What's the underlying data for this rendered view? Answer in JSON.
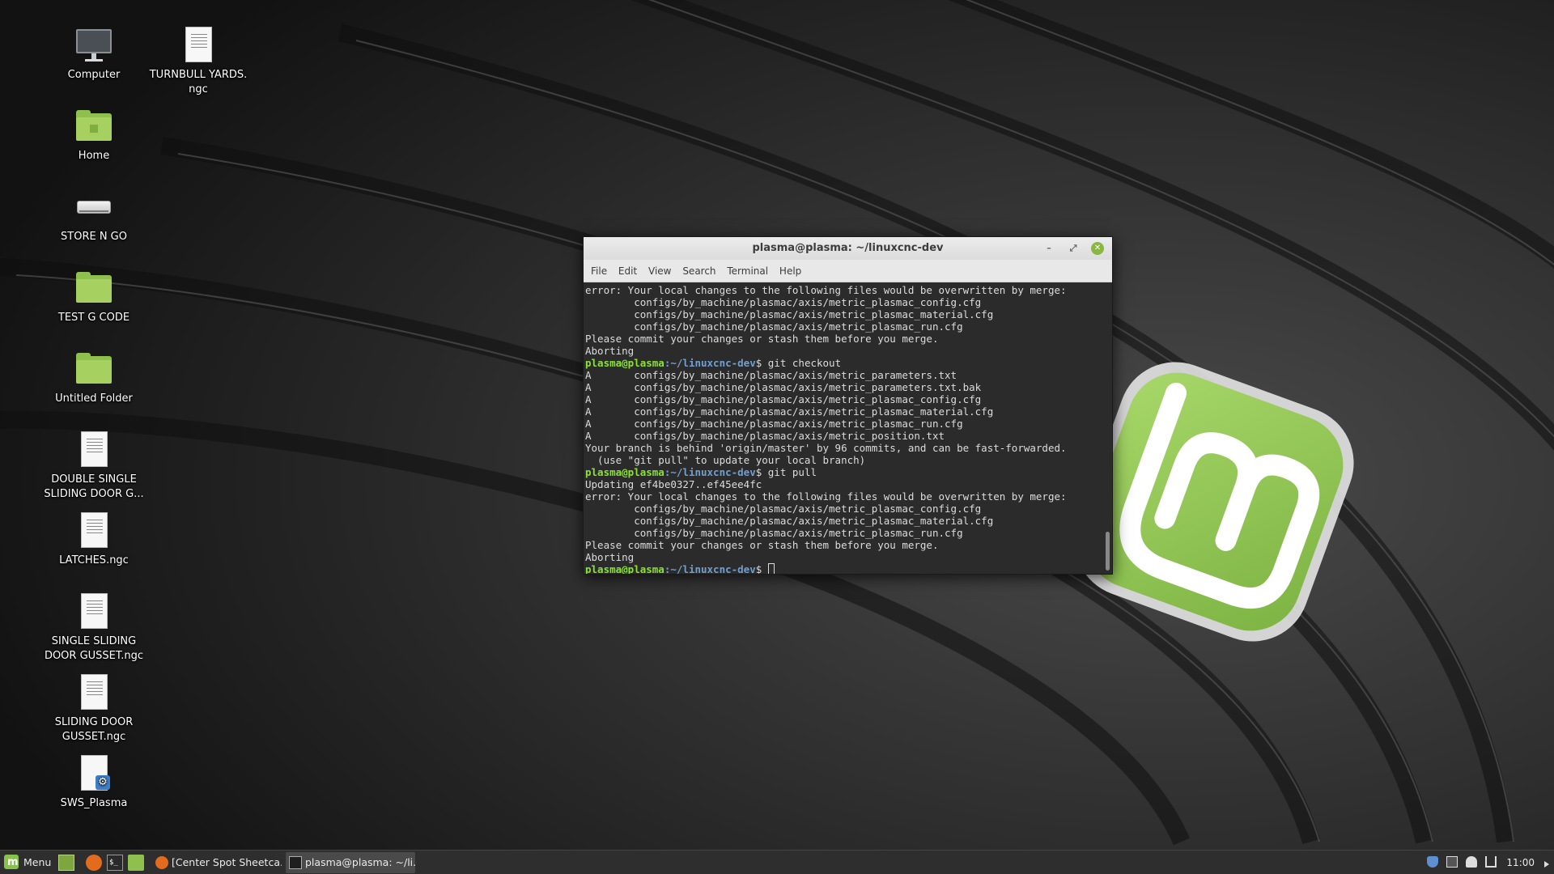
{
  "desktop": {
    "icons": [
      {
        "label": "Computer",
        "type": "computer"
      },
      {
        "label": "TURNBULL YARDS.\nngc",
        "type": "document"
      },
      {
        "label": "Home",
        "type": "home-folder"
      },
      {
        "label": "STORE N GO",
        "type": "drive"
      },
      {
        "label": "TEST G CODE",
        "type": "folder"
      },
      {
        "label": "Untitled Folder",
        "type": "folder"
      },
      {
        "label": "DOUBLE SINGLE\nSLIDING DOOR G...",
        "type": "document"
      },
      {
        "label": "LATCHES.ngc",
        "type": "document"
      },
      {
        "label": "SINGLE SLIDING\nDOOR GUSSET.ngc",
        "type": "document"
      },
      {
        "label": "SLIDING DOOR\nGUSSET.ngc",
        "type": "document"
      },
      {
        "label": "SWS_Plasma",
        "type": "executable"
      }
    ]
  },
  "terminal": {
    "title": "plasma@plasma: ~/linuxcnc-dev",
    "menu": [
      "File",
      "Edit",
      "View",
      "Search",
      "Terminal",
      "Help"
    ],
    "prompt_user": "plasma@plasma",
    "prompt_path": ":~/linuxcnc-dev",
    "prompt_symbol": "$ ",
    "lines": [
      {
        "text": "error: Your local changes to the following files would be overwritten by merge:"
      },
      {
        "text": "        configs/by_machine/plasmac/axis/metric_plasmac_config.cfg"
      },
      {
        "text": "        configs/by_machine/plasmac/axis/metric_plasmac_material.cfg"
      },
      {
        "text": "        configs/by_machine/plasmac/axis/metric_plasmac_run.cfg"
      },
      {
        "text": "Please commit your changes or stash them before you merge."
      },
      {
        "text": "Aborting"
      },
      {
        "prompt": true,
        "text": "git checkout"
      },
      {
        "text": "A       configs/by_machine/plasmac/axis/metric_parameters.txt"
      },
      {
        "text": "A       configs/by_machine/plasmac/axis/metric_parameters.txt.bak"
      },
      {
        "text": "A       configs/by_machine/plasmac/axis/metric_plasmac_config.cfg"
      },
      {
        "text": "A       configs/by_machine/plasmac/axis/metric_plasmac_material.cfg"
      },
      {
        "text": "A       configs/by_machine/plasmac/axis/metric_plasmac_run.cfg"
      },
      {
        "text": "A       configs/by_machine/plasmac/axis/metric_position.txt"
      },
      {
        "text": "Your branch is behind 'origin/master' by 96 commits, and can be fast-forwarded."
      },
      {
        "text": "  (use \"git pull\" to update your local branch)"
      },
      {
        "prompt": true,
        "text": "git pull"
      },
      {
        "text": "Updating ef4be0327..ef45ee4fc"
      },
      {
        "text": "error: Your local changes to the following files would be overwritten by merge:"
      },
      {
        "text": "        configs/by_machine/plasmac/axis/metric_plasmac_config.cfg"
      },
      {
        "text": "        configs/by_machine/plasmac/axis/metric_plasmac_material.cfg"
      },
      {
        "text": "        configs/by_machine/plasmac/axis/metric_plasmac_run.cfg"
      },
      {
        "text": "Please commit your changes or stash them before you merge."
      },
      {
        "text": "Aborting"
      },
      {
        "prompt": true,
        "text": "",
        "cursor": true
      }
    ]
  },
  "taskbar": {
    "menu_label": "Menu",
    "launchers": [
      "show-desktop-icon",
      "firefox-icon",
      "terminal-icon",
      "files-icon"
    ],
    "tasks": [
      {
        "label": "[Center Spot Sheetca...",
        "icon": "firefox-icon",
        "active": false
      },
      {
        "label": "plasma@plasma: ~/li...",
        "icon": "terminal-icon",
        "active": true
      }
    ],
    "tray": {
      "icons": [
        "shield-icon",
        "update-manager-icon",
        "user-icon",
        "network-icon",
        "volume-icon"
      ],
      "clock": "11:00"
    }
  },
  "colors": {
    "prompt_user": "#8ae234",
    "prompt_path": "#729fcf",
    "mint_green": "#87c24a",
    "terminal_bg": "#2b2b2b"
  }
}
